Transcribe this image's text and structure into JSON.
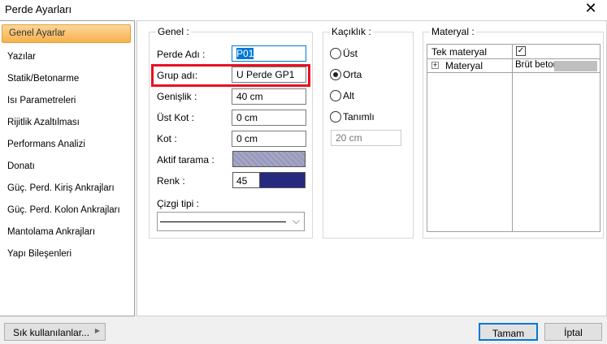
{
  "window": {
    "title": "Perde Ayarları",
    "close": "✕"
  },
  "sidebar": {
    "items": [
      {
        "label": "Genel Ayarlar",
        "active": true
      },
      {
        "label": "Yazılar"
      },
      {
        "label": "Statik/Betonarme"
      },
      {
        "label": "Isı Parametreleri"
      },
      {
        "label": "Rijitlik Azaltılması"
      },
      {
        "label": "Performans Analizi"
      },
      {
        "label": "Donatı"
      },
      {
        "label": "Güç. Perd. Kiriş Ankrajları"
      },
      {
        "label": "Güç. Perd. Kolon Ankrajları"
      },
      {
        "label": "Mantolama Ankrajları"
      },
      {
        "label": "Yapı Bileşenleri"
      }
    ]
  },
  "genel": {
    "title": "Genel :",
    "perde_adi": {
      "label": "Perde Adı :",
      "value": "P01"
    },
    "grup_adi": {
      "label": "Grup adı:",
      "value": "U Perde GP1"
    },
    "genislik": {
      "label": "Genişlik :",
      "value": "40 cm"
    },
    "ust_kot": {
      "label": "Üst Kot :",
      "value": "0 cm"
    },
    "kot": {
      "label": "Kot :",
      "value": "0 cm"
    },
    "aktif_tarama": {
      "label": "Aktif tarama :",
      "color": "#9999bb"
    },
    "renk": {
      "label": "Renk :",
      "value": "45",
      "color": "#262a7e"
    },
    "cizgi_tipi": {
      "label": "Çizgi tipi :"
    }
  },
  "kaciklik": {
    "title": "Kaçıklık :",
    "options": [
      "Üst",
      "Orta",
      "Alt",
      "Tanımlı"
    ],
    "selected": "Orta",
    "tanimli_value": "20 cm"
  },
  "materyal": {
    "title": "Materyal :",
    "rows": [
      {
        "name": "Tek materyal",
        "checked": true
      },
      {
        "name": "Materyal",
        "value": "Brüt beton",
        "expand": "+"
      }
    ]
  },
  "footer": {
    "favorites": "Sık kullanılanlar...",
    "ok": "Tamam",
    "cancel": "İptal"
  },
  "colors": {
    "highlight": "#e81123",
    "accent": "#0078d7"
  }
}
